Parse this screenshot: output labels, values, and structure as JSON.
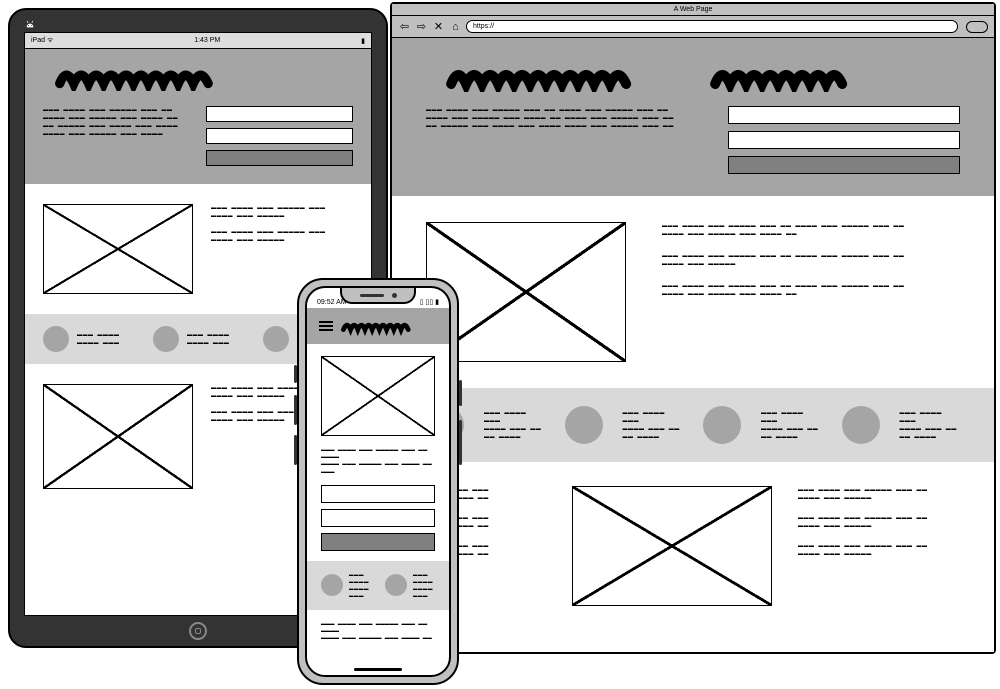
{
  "browser": {
    "window_title": "A Web Page",
    "url_prefix": "https://"
  },
  "tablet": {
    "status_left": "iPad ᯤ",
    "status_center": "1:43 PM",
    "status_right": "▮"
  },
  "phone": {
    "status_time": "09:52 AM",
    "status_right": "▯ ▯▯ ▮"
  }
}
